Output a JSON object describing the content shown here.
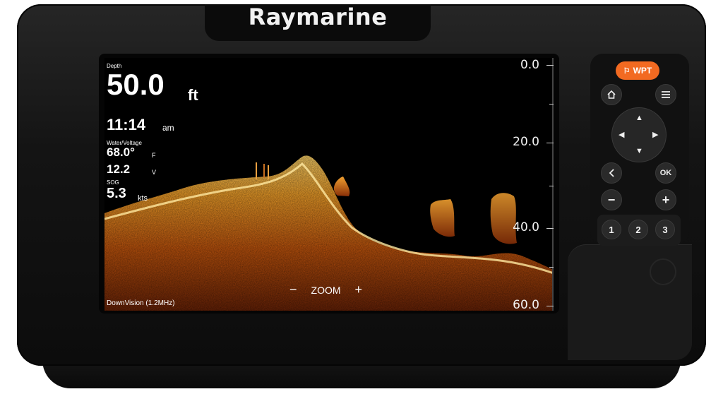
{
  "brand": {
    "name": "Raymarine"
  },
  "display": {
    "depth": {
      "label": "Depth",
      "value": "50.0",
      "unit": "ft"
    },
    "time": {
      "value": "11:14",
      "suffix": "am"
    },
    "water_voltage": {
      "label": "Water/Voltage",
      "water_value": "68.0°",
      "water_unit": "F",
      "voltage_value": "12.2",
      "voltage_unit": "V"
    },
    "sog": {
      "label": "SOG",
      "value": "5.3",
      "unit": "kts"
    },
    "mode": "DownVision (1.2MHz)",
    "zoom": {
      "label": "ZOOM",
      "minus": "−",
      "plus": "+"
    },
    "depth_scale": [
      "0.0",
      "20.0",
      "40.0",
      "60.0"
    ]
  },
  "keypad": {
    "wpt_label": "WPT",
    "home_icon": "home-icon",
    "menu_icon": "menu-icon",
    "dpad_icons": [
      "arrow-up-icon",
      "arrow-left-icon",
      "arrow-right-icon",
      "arrow-down-icon"
    ],
    "back_icon": "back-icon",
    "ok_label": "OK",
    "minus_label": "−",
    "plus_label": "+",
    "numbers": [
      "1",
      "2",
      "3"
    ]
  },
  "colors": {
    "accent": "#f26a21",
    "sonar_bright": "#ffcf5a",
    "sonar_mid": "#e07a12",
    "sonar_dark": "#7a2a06"
  }
}
